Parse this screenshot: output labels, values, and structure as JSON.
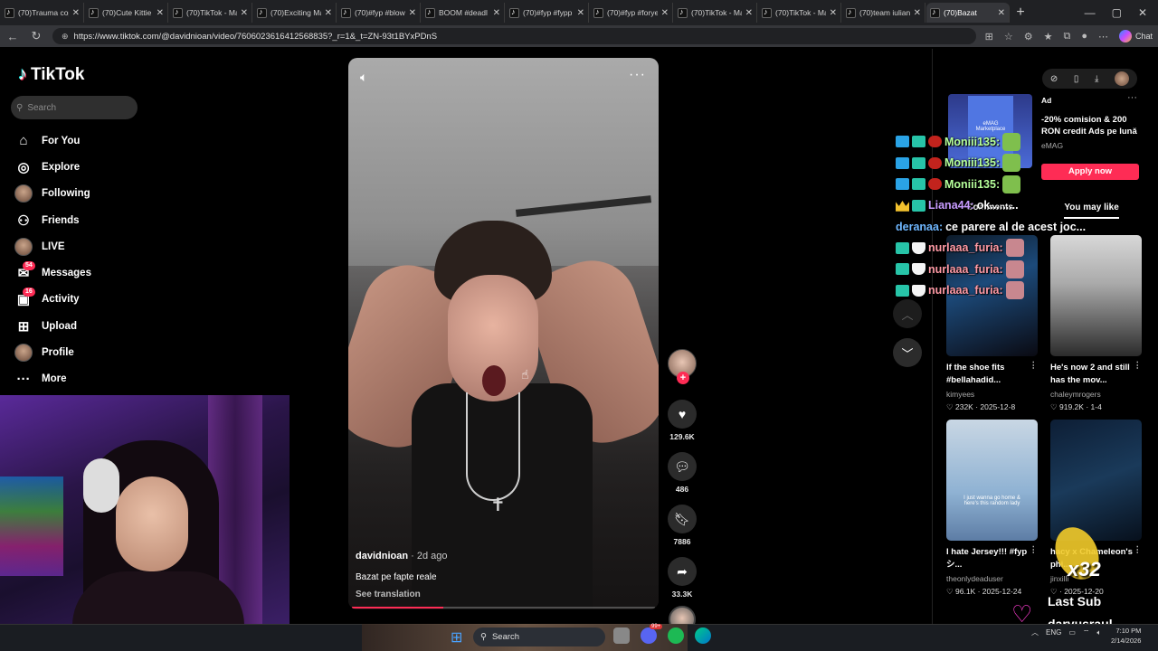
{
  "browser": {
    "tabs": [
      {
        "title": "(70)Trauma cop",
        "active": false
      },
      {
        "title": "(70)Cute Kittie",
        "active": false
      },
      {
        "title": "(70)TikTok - Ma",
        "active": false
      },
      {
        "title": "(70)Exciting Ma",
        "active": false
      },
      {
        "title": "(70)#fyp #blow",
        "active": false
      },
      {
        "title": "BOOM #deadl",
        "active": false
      },
      {
        "title": "(70)#fyp #fypp",
        "active": false
      },
      {
        "title": "(70)#fyp #forye",
        "active": false
      },
      {
        "title": "(70)TikTok - Ma",
        "active": false
      },
      {
        "title": "(70)TikTok - Ma",
        "active": false
      },
      {
        "title": "(70)team iulian",
        "active": false
      },
      {
        "title": "(70)Bazat",
        "active": true
      }
    ],
    "url": "https://www.tiktok.com/@davidnioan/video/7606023616412568835?_r=1&_t=ZN-93t1BYxPDnS",
    "copilot_label": "Chat"
  },
  "tiktok": {
    "brand": "TikTok",
    "search_placeholder": "Search",
    "nav": [
      {
        "label": "For You",
        "icon": "home-icon"
      },
      {
        "label": "Explore",
        "icon": "compass-icon"
      },
      {
        "label": "Following",
        "icon": "avatar-icon"
      },
      {
        "label": "Friends",
        "icon": "friends-icon"
      },
      {
        "label": "LIVE",
        "icon": "live-icon"
      },
      {
        "label": "Messages",
        "icon": "messages-icon",
        "badge": "54"
      },
      {
        "label": "Activity",
        "icon": "activity-icon",
        "badge": "16"
      },
      {
        "label": "Upload",
        "icon": "upload-icon"
      },
      {
        "label": "Profile",
        "icon": "profile-icon"
      },
      {
        "label": "More",
        "icon": "more-icon"
      }
    ]
  },
  "video": {
    "author": "davidnioan",
    "posted": " · 2d ago",
    "description": "Bazat pe fapte reale",
    "see_translation": "See translation",
    "progress": 0.3,
    "likes": "129.6K",
    "comments": "486",
    "saves": "7886",
    "shares": "33.3K"
  },
  "ad": {
    "label": "Ad",
    "title": "-20% comision & 200 RON credit Ads pe lună",
    "brand": "eMAG",
    "image_text": "eMAG Marketplace",
    "cta": "Apply now"
  },
  "panel_tabs": {
    "comments": "Comments",
    "you_may_like": "You may like"
  },
  "recommendations": [
    {
      "title": "If the shoe fits #bellahadid...",
      "user": "kimyees",
      "likes": "232K",
      "date": "2025-12-8"
    },
    {
      "title": "He's now 2 and still has the mov...",
      "user": "chaleymrogers",
      "likes": "919.2K",
      "date": "1-4"
    },
    {
      "title": "I hate Jersey!!! #fypシ...",
      "user": "theonlydeaduser",
      "likes": "96.1K",
      "date": "2025-12-24",
      "thumb_text": "I just wanna go home & here's this random lady"
    },
    {
      "title": "hacy x Chameleon's phi...",
      "user": "jinxilli",
      "likes": "",
      "date": "2025-12-20"
    }
  ],
  "chat": [
    {
      "user": "Moniii135:",
      "msg": "",
      "color": "#b6ff9a"
    },
    {
      "user": "Moniii135:",
      "msg": "",
      "color": "#b6ff9a"
    },
    {
      "user": "Moniii135:",
      "msg": "",
      "color": "#b6ff9a"
    },
    {
      "user": "Liana44:",
      "msg": " ok.........",
      "color": "#c79bff"
    },
    {
      "user": "deranaa:",
      "msg": " ce parere al de acest joc...",
      "color": "#6fb7ff"
    },
    {
      "user": "nurlaaa_furia:",
      "msg": "",
      "color": "#ff9aa5"
    },
    {
      "user": "nurlaaa_furia:",
      "msg": "",
      "color": "#ff9aa5"
    },
    {
      "user": "nurlaaa_furia:",
      "msg": "",
      "color": "#ff9aa5"
    }
  ],
  "sub_alert": {
    "multiplier": "x32",
    "label": "Last Sub",
    "name": "daryusraul"
  },
  "taskbar": {
    "search_placeholder": "Search",
    "messenger_badge": "99+",
    "lang": "ENG",
    "time": "7:10 PM",
    "date": "2/14/2026"
  },
  "colors": {
    "accent": "#fe2c55",
    "background": "#000000"
  }
}
